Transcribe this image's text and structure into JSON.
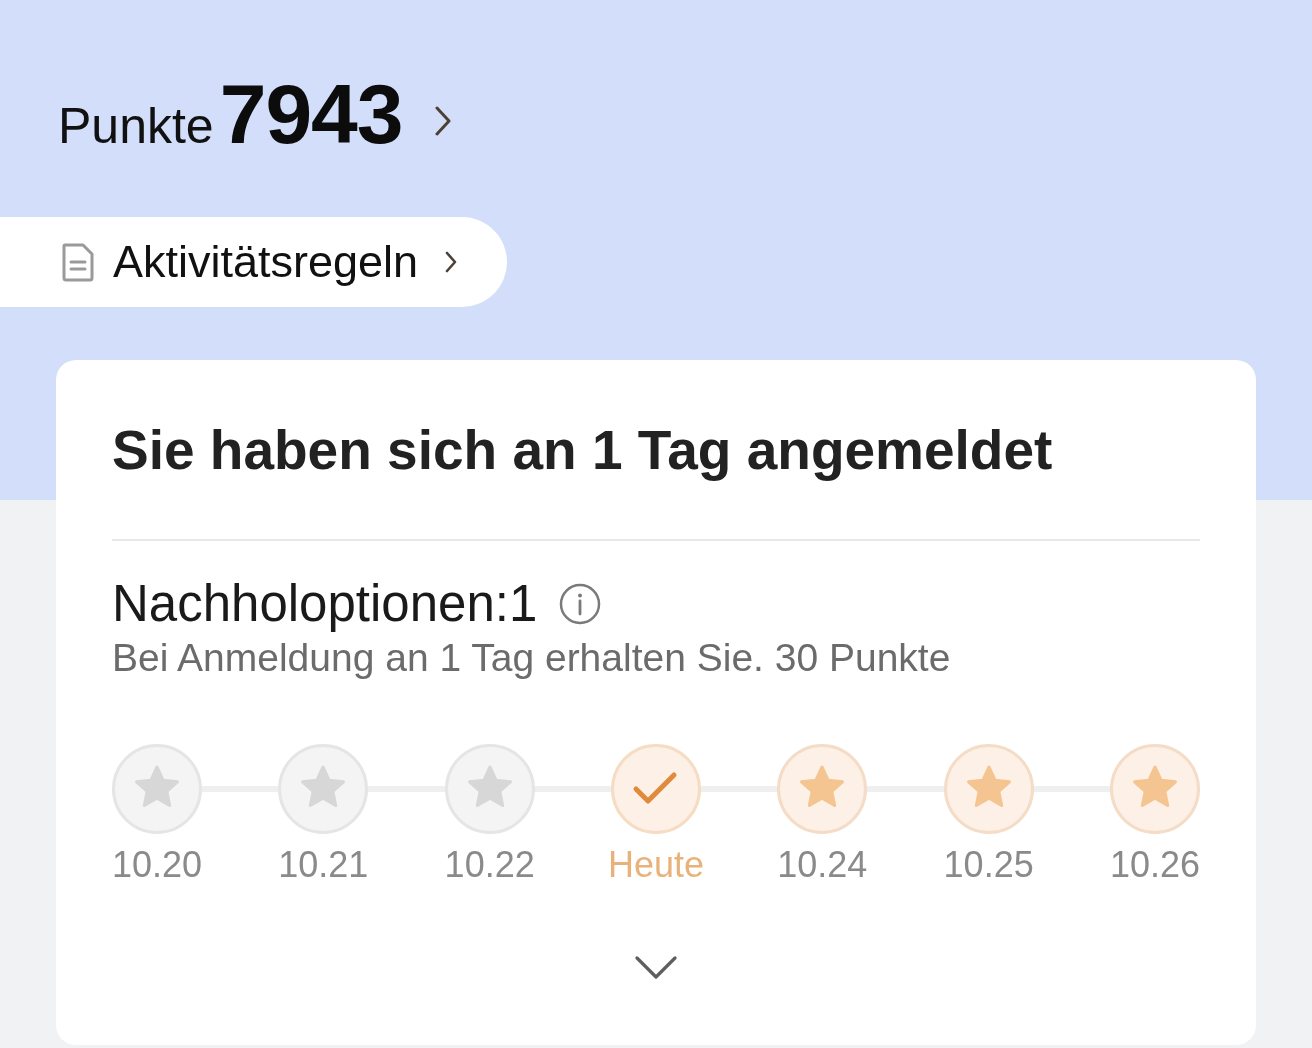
{
  "header": {
    "points_label": "Punkte",
    "points_value": "7943"
  },
  "rules_link": {
    "label": "Aktivitätsregeln"
  },
  "checkin_card": {
    "title": "Sie haben sich an 1 Tag angemeldet",
    "makeup": {
      "label": "Nachholoptionen:1"
    },
    "reward_text": "Bei Anmeldung an 1 Tag erhalten Sie. 30 Punkte",
    "days": [
      {
        "label": "10.20",
        "kind": "missed"
      },
      {
        "label": "10.21",
        "kind": "missed"
      },
      {
        "label": "10.22",
        "kind": "missed"
      },
      {
        "label": "Heute",
        "kind": "today"
      },
      {
        "label": "10.24",
        "kind": "upcoming"
      },
      {
        "label": "10.25",
        "kind": "upcoming"
      },
      {
        "label": "10.26",
        "kind": "upcoming"
      }
    ]
  }
}
